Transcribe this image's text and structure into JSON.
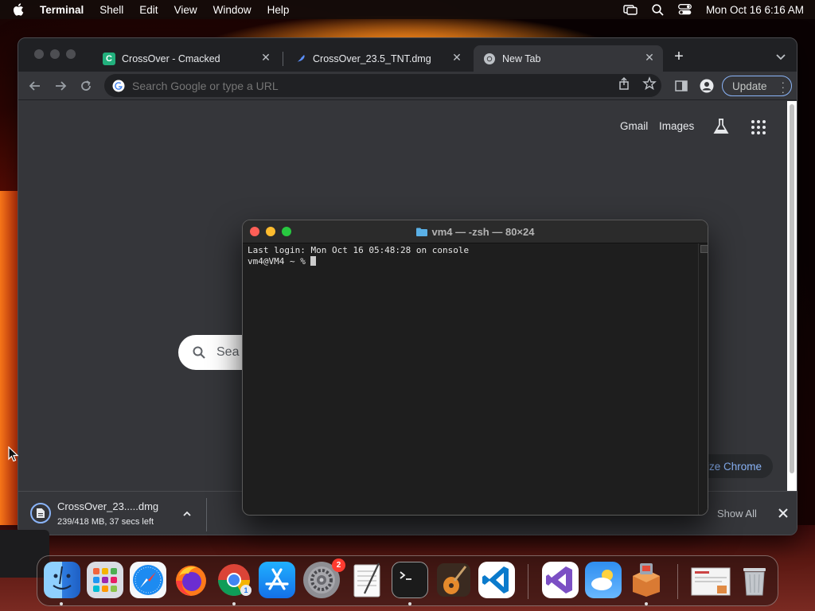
{
  "menubar": {
    "app_name": "Terminal",
    "items": [
      "Shell",
      "Edit",
      "View",
      "Window",
      "Help"
    ],
    "datetime": "Mon Oct 16  6:16 AM"
  },
  "chrome": {
    "tabs": [
      {
        "title": "CrossOver - Cmacked",
        "favicon": "C"
      },
      {
        "title": "CrossOver_23.5_TNT.dmg",
        "favicon": "feather"
      },
      {
        "title": "New Tab",
        "favicon": "chrome"
      }
    ],
    "omnibox_placeholder": "Search Google or type a URL",
    "update_label": "Update",
    "ntp": {
      "gmail": "Gmail",
      "images": "Images",
      "search_partial": "Sea",
      "customize_partial": "ize Chrome"
    },
    "download": {
      "filename": "CrossOver_23.....dmg",
      "status": "239/418 MB, 37 secs left",
      "show_all": "Show All"
    }
  },
  "terminal": {
    "title": "vm4 — -zsh — 80×24",
    "lines": [
      "Last login: Mon Oct 16 05:48:28 on console",
      "vm4@VM4 ~ % "
    ]
  },
  "dock": {
    "items": [
      "finder",
      "launchpad",
      "safari",
      "firefox",
      "chrome",
      "app-store",
      "system-settings",
      "textedit",
      "terminal",
      "garageband",
      "vscode",
      "visual-studio",
      "weather",
      "crossover",
      "preview-thumbnail",
      "trash"
    ],
    "settings_badge": "2",
    "chrome_badge": "1"
  },
  "colors": {
    "chrome_bg": "#35363a",
    "tabstrip_bg": "#202124",
    "accent_blue": "#8ab4f8",
    "terminal_bg": "#1e1e1e"
  }
}
